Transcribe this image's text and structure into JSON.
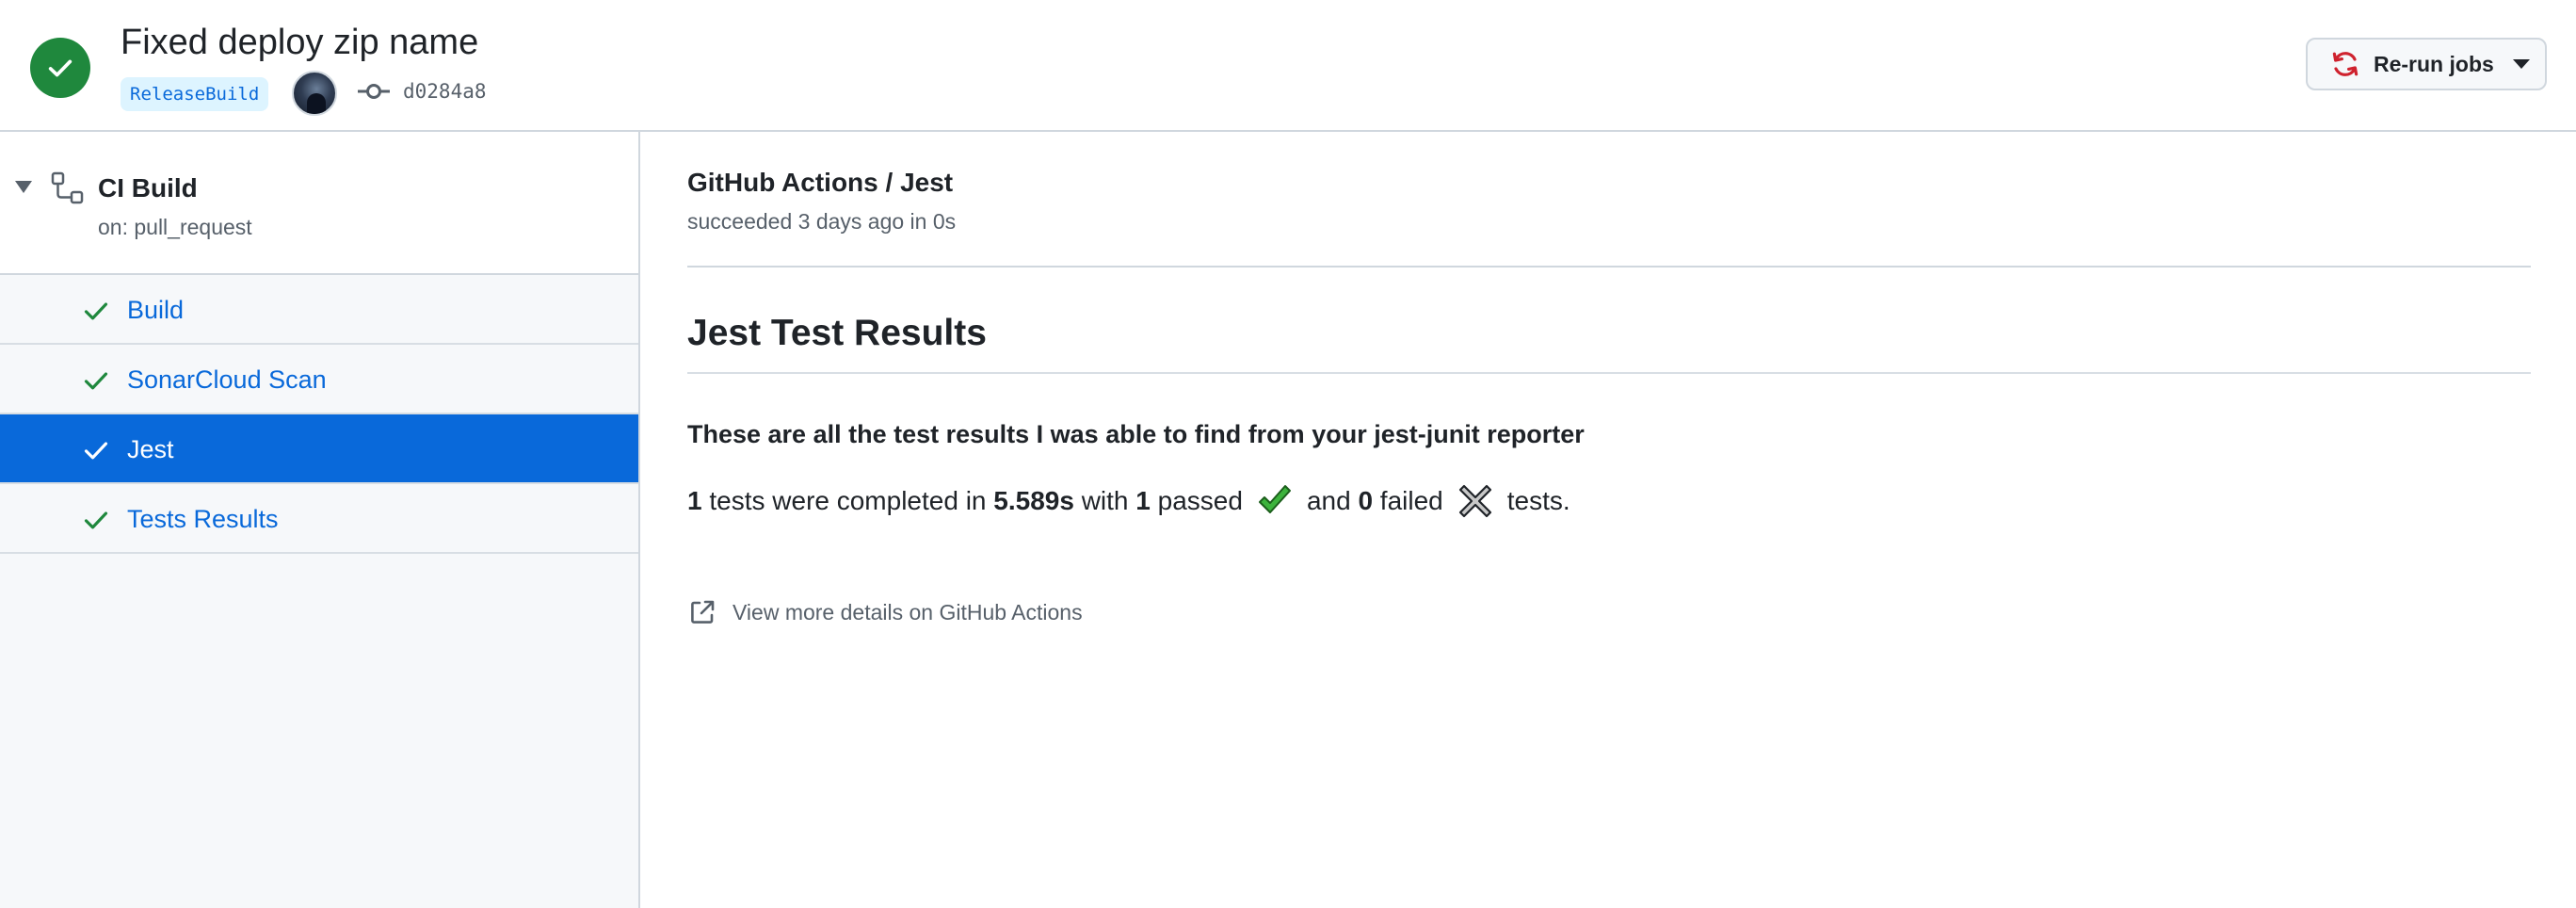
{
  "header": {
    "commit_title": "Fixed deploy zip name",
    "branch": "ReleaseBuild",
    "commit_sha": "d0284a8",
    "rerun_label": "Re-run jobs",
    "status_color": "#1f883d"
  },
  "sidebar": {
    "workflow_name": "CI Build",
    "workflow_trigger": "on: pull_request",
    "jobs": [
      {
        "label": "Build",
        "status": "success"
      },
      {
        "label": "SonarCloud Scan",
        "status": "success"
      },
      {
        "label": "Jest",
        "status": "success",
        "selected": true
      },
      {
        "label": "Tests Results",
        "status": "success"
      }
    ]
  },
  "main": {
    "check_title": "GitHub Actions / Jest",
    "check_subtitle": "succeeded 3 days ago in 0s",
    "section_title": "Jest Test Results",
    "intro": "These are all the test results I was able to find from your jest-junit reporter",
    "summary": {
      "tests_count": "1",
      "text_a": "tests were completed in",
      "duration": "5.589s",
      "text_b": "with",
      "passed_count": "1",
      "text_c": "passed",
      "text_d": "and",
      "failed_count": "0",
      "text_e": "failed",
      "text_f": "tests."
    },
    "details_link": "View more details on GitHub Actions"
  },
  "icons": {
    "status": "check-circle-icon",
    "commit": "git-commit-icon",
    "rerun": "sync-icon",
    "workflow": "workflow-icon",
    "job_status": "check-icon",
    "passed": "heavy-check-mark-icon",
    "failed": "heavy-multiplication-x-icon",
    "external": "link-external-icon"
  },
  "colors": {
    "accent": "#0969da",
    "success": "#1f883d",
    "rerun_icon": "#cf222e"
  }
}
